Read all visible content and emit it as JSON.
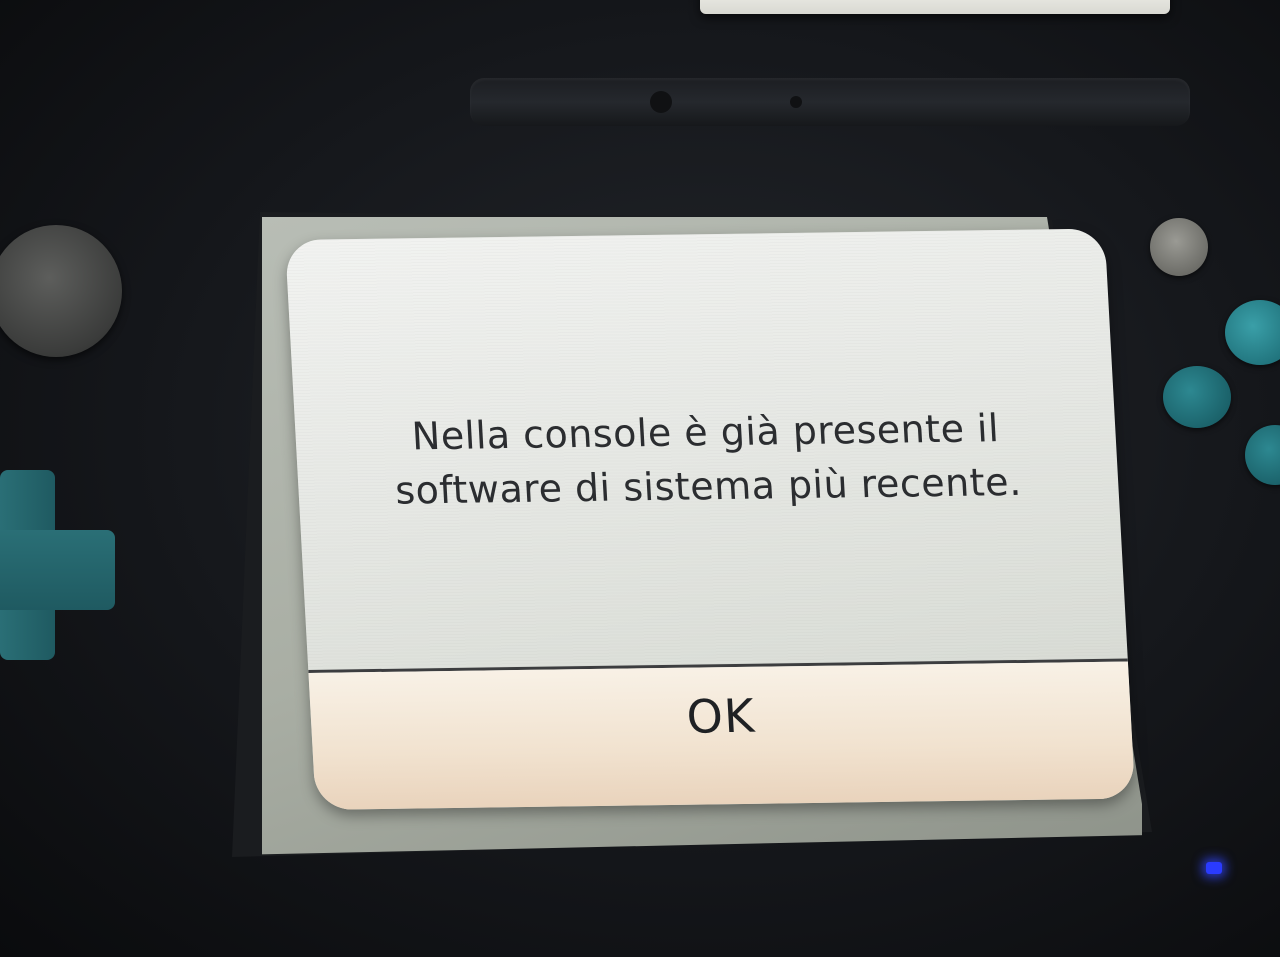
{
  "dialog": {
    "message": "Nella console è già presente il\nsoftware di sistema più recente.",
    "ok_label": "OK"
  },
  "colors": {
    "dialog_background": "#e6e8e4",
    "button_background": "#f1e2cf",
    "text": "#2b2d30",
    "console_accent": "#1f5a61",
    "power_led": "#2a3bff"
  }
}
